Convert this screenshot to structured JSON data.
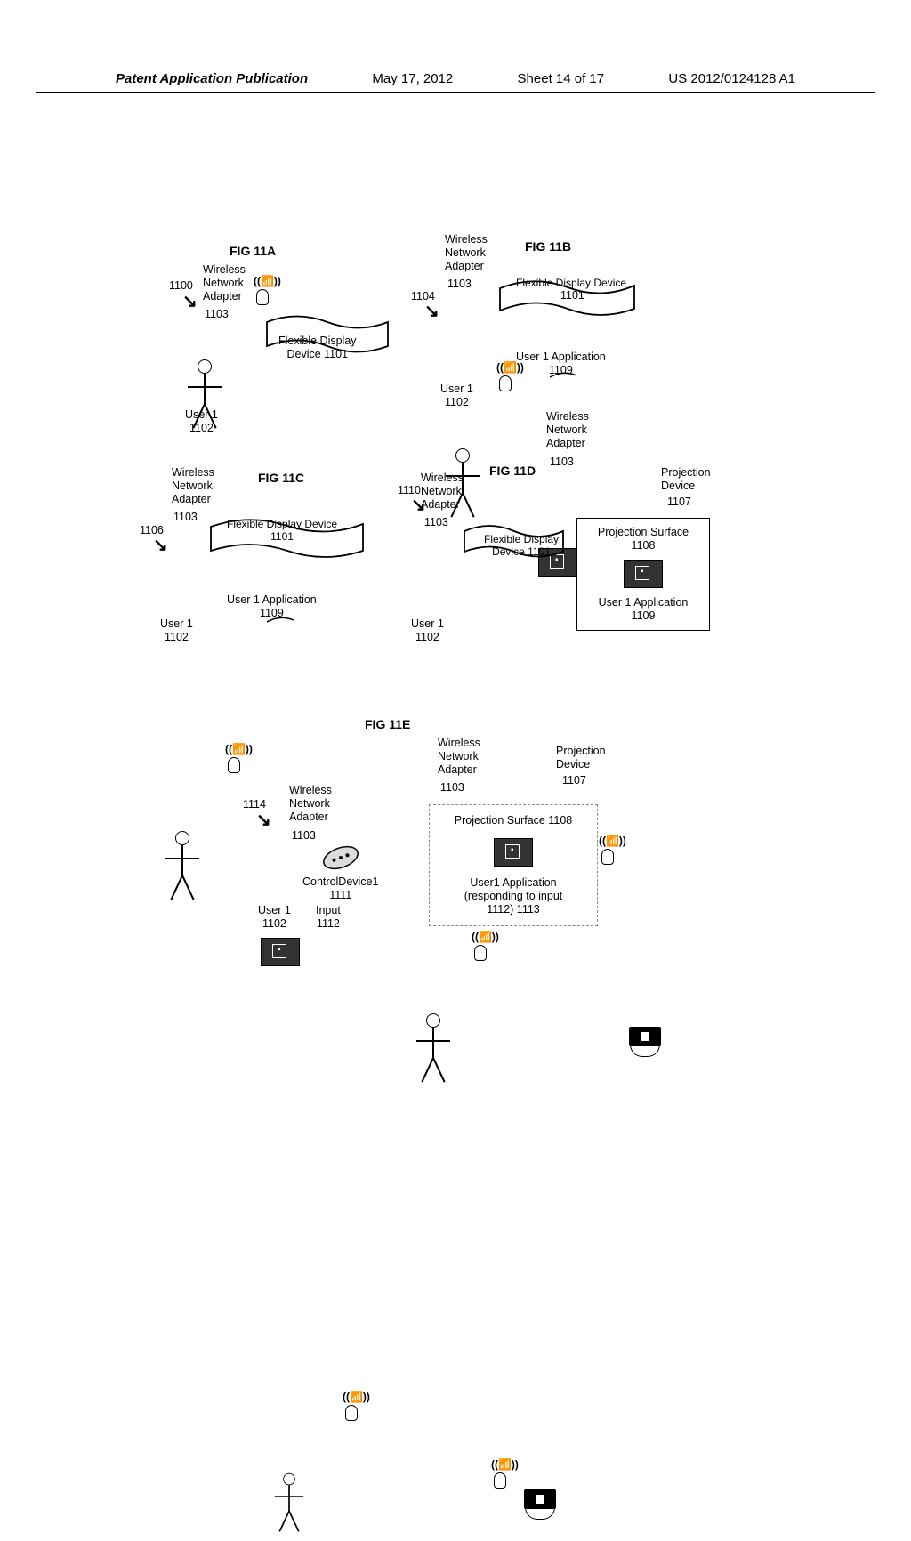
{
  "header": {
    "left": "Patent Application Publication",
    "date": "May 17, 2012",
    "sheet": "Sheet 14 of 17",
    "pubno": "US 2012/0124128 A1"
  },
  "labels": {
    "wireless_network_adapter": "Wireless\nNetwork\nAdapter",
    "wireless_network_adapter_num": "1103",
    "user1": "User 1",
    "user1_num": "1102",
    "flex_display": "Flexible Display",
    "flex_display_device": "Flexible Display Device",
    "flex_display_num": "1101",
    "user1_app": "User 1 Application",
    "user1_app_num": "1109",
    "proj_device": "Projection\nDevice",
    "proj_device_num": "1107",
    "proj_surface": "Projection Surface",
    "proj_surface_num": "1108",
    "control_device": "ControlDevice1",
    "control_device_num": "1111",
    "input": "Input",
    "input_num": "1112",
    "user1_app_resp": "User1 Application\n(responding to input\n1112) 1113",
    "proj_surface_1108": "Projection Surface 1108"
  },
  "figs": {
    "a": {
      "title": "FIG 11A",
      "ref": "1100"
    },
    "b": {
      "title": "FIG 11B",
      "ref": "1104"
    },
    "c": {
      "title": "FIG 11C",
      "ref": "1106"
    },
    "d": {
      "title": "FIG 11D",
      "ref": "1110"
    },
    "e": {
      "title": "FIG 11E",
      "ref": "1114"
    }
  }
}
